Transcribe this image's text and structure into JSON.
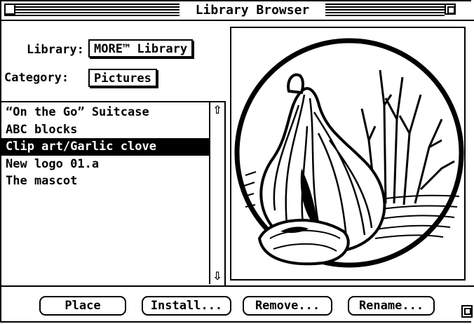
{
  "window": {
    "title": "Library Browser"
  },
  "library": {
    "label": "Library:",
    "value": "MORE™ Library"
  },
  "category": {
    "label": "Category:",
    "value": "Pictures"
  },
  "list": {
    "items": [
      {
        "label": "“On the Go” Suitcase",
        "selected": false
      },
      {
        "label": "ABC blocks",
        "selected": false
      },
      {
        "label": "Clip art/Garlic clove",
        "selected": true
      },
      {
        "label": "New logo 01.a",
        "selected": false
      },
      {
        "label": "The mascot",
        "selected": false
      }
    ]
  },
  "preview": {
    "image": "garlic-clove-illustration"
  },
  "buttons": {
    "place": "Place",
    "install": "Install...",
    "remove": "Remove...",
    "rename": "Rename..."
  },
  "icons": {
    "close": "close-box-icon",
    "zoom": "zoom-box-icon",
    "scroll_up": "up-arrow-icon",
    "scroll_down": "down-arrow-icon",
    "grow": "size-box-icon"
  }
}
